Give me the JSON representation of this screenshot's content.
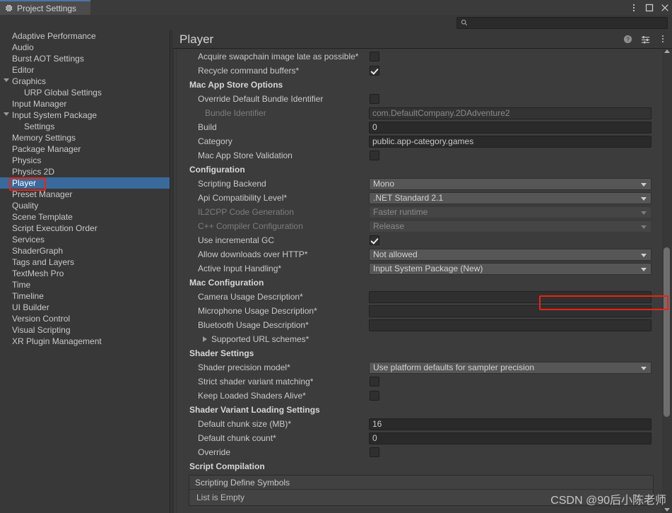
{
  "window": {
    "tab_label": "Project Settings",
    "tab_icon": "gear-icon",
    "menu_icon": "kebab-menu-icon",
    "maximize_icon": "maximize-icon",
    "close_icon": "close-icon"
  },
  "search": {
    "value": "",
    "placeholder": "",
    "icon": "search-icon"
  },
  "sidebar": {
    "items": [
      {
        "label": "Adaptive Performance",
        "indent": 0,
        "arrow": false,
        "selected": false
      },
      {
        "label": "Audio",
        "indent": 0,
        "arrow": false,
        "selected": false
      },
      {
        "label": "Burst AOT Settings",
        "indent": 0,
        "arrow": false,
        "selected": false
      },
      {
        "label": "Editor",
        "indent": 0,
        "arrow": false,
        "selected": false
      },
      {
        "label": "Graphics",
        "indent": 0,
        "arrow": true,
        "selected": false
      },
      {
        "label": "URP Global Settings",
        "indent": 1,
        "arrow": false,
        "selected": false
      },
      {
        "label": "Input Manager",
        "indent": 0,
        "arrow": false,
        "selected": false
      },
      {
        "label": "Input System Package",
        "indent": 0,
        "arrow": true,
        "selected": false
      },
      {
        "label": "Settings",
        "indent": 1,
        "arrow": false,
        "selected": false
      },
      {
        "label": "Memory Settings",
        "indent": 0,
        "arrow": false,
        "selected": false
      },
      {
        "label": "Package Manager",
        "indent": 0,
        "arrow": false,
        "selected": false
      },
      {
        "label": "Physics",
        "indent": 0,
        "arrow": false,
        "selected": false
      },
      {
        "label": "Physics 2D",
        "indent": 0,
        "arrow": false,
        "selected": false
      },
      {
        "label": "Player",
        "indent": 0,
        "arrow": false,
        "selected": true
      },
      {
        "label": "Preset Manager",
        "indent": 0,
        "arrow": false,
        "selected": false
      },
      {
        "label": "Quality",
        "indent": 0,
        "arrow": false,
        "selected": false
      },
      {
        "label": "Scene Template",
        "indent": 0,
        "arrow": false,
        "selected": false
      },
      {
        "label": "Script Execution Order",
        "indent": 0,
        "arrow": false,
        "selected": false
      },
      {
        "label": "Services",
        "indent": 0,
        "arrow": false,
        "selected": false
      },
      {
        "label": "ShaderGraph",
        "indent": 0,
        "arrow": false,
        "selected": false
      },
      {
        "label": "Tags and Layers",
        "indent": 0,
        "arrow": false,
        "selected": false
      },
      {
        "label": "TextMesh Pro",
        "indent": 0,
        "arrow": false,
        "selected": false
      },
      {
        "label": "Time",
        "indent": 0,
        "arrow": false,
        "selected": false
      },
      {
        "label": "Timeline",
        "indent": 0,
        "arrow": false,
        "selected": false
      },
      {
        "label": "UI Builder",
        "indent": 0,
        "arrow": false,
        "selected": false
      },
      {
        "label": "Version Control",
        "indent": 0,
        "arrow": false,
        "selected": false
      },
      {
        "label": "Visual Scripting",
        "indent": 0,
        "arrow": false,
        "selected": false
      },
      {
        "label": "XR Plugin Management",
        "indent": 0,
        "arrow": false,
        "selected": false
      }
    ]
  },
  "main": {
    "title": "Player",
    "help_icon": "help-icon",
    "preset_icon": "preset-settings-icon",
    "more_icon": "kebab-menu-icon"
  },
  "rows": [
    {
      "kind": "checkbox",
      "label": "Acquire swapchain image late as possible*",
      "indent": 1,
      "checked": false
    },
    {
      "kind": "checkbox",
      "label": "Recycle command buffers*",
      "indent": 1,
      "checked": true
    },
    {
      "kind": "section",
      "label": "Mac App Store Options"
    },
    {
      "kind": "checkbox",
      "label": "Override Default Bundle Identifier",
      "indent": 1,
      "checked": false
    },
    {
      "kind": "text",
      "label": "Bundle Identifier",
      "indent": 2,
      "value": "com.DefaultCompany.2DAdventure2",
      "disabled": true
    },
    {
      "kind": "text",
      "label": "Build",
      "indent": 1,
      "value": "0",
      "disabled": false
    },
    {
      "kind": "text",
      "label": "Category",
      "indent": 1,
      "value": "public.app-category.games",
      "disabled": false
    },
    {
      "kind": "checkbox",
      "label": "Mac App Store Validation",
      "indent": 1,
      "checked": false
    },
    {
      "kind": "section",
      "label": "Configuration"
    },
    {
      "kind": "dropdown",
      "label": "Scripting Backend",
      "indent": 1,
      "value": "Mono",
      "disabled": false
    },
    {
      "kind": "dropdown",
      "label": "Api Compatibility Level*",
      "indent": 1,
      "value": ".NET Standard 2.1",
      "disabled": false
    },
    {
      "kind": "dropdown",
      "label": "IL2CPP Code Generation",
      "indent": 1,
      "value": "Faster runtime",
      "disabled": true
    },
    {
      "kind": "dropdown",
      "label": "C++ Compiler Configuration",
      "indent": 1,
      "value": "Release",
      "disabled": true
    },
    {
      "kind": "checkbox",
      "label": "Use incremental GC",
      "indent": 1,
      "checked": true
    },
    {
      "kind": "dropdown",
      "label": "Allow downloads over HTTP*",
      "indent": 1,
      "value": "Not allowed",
      "disabled": false
    },
    {
      "kind": "dropdown",
      "label": "Active Input Handling*",
      "indent": 1,
      "value": "Input System Package (New)",
      "disabled": false,
      "highlighted": true
    },
    {
      "kind": "section",
      "label": "Mac Configuration"
    },
    {
      "kind": "text",
      "label": "Camera Usage Description*",
      "indent": 1,
      "value": "",
      "disabled": false
    },
    {
      "kind": "text",
      "label": "Microphone Usage Description*",
      "indent": 1,
      "value": "",
      "disabled": false
    },
    {
      "kind": "text",
      "label": "Bluetooth Usage Description*",
      "indent": 1,
      "value": "",
      "disabled": false
    },
    {
      "kind": "foldout",
      "label": "Supported URL schemes*",
      "indent": 1
    },
    {
      "kind": "section",
      "label": "Shader Settings"
    },
    {
      "kind": "dropdown",
      "label": "Shader precision model*",
      "indent": 1,
      "value": "Use platform defaults for sampler precision",
      "disabled": false
    },
    {
      "kind": "checkbox",
      "label": "Strict shader variant matching*",
      "indent": 1,
      "checked": false
    },
    {
      "kind": "checkbox",
      "label": "Keep Loaded Shaders Alive*",
      "indent": 1,
      "checked": false
    },
    {
      "kind": "section",
      "label": "Shader Variant Loading Settings"
    },
    {
      "kind": "text",
      "label": "Default chunk size (MB)*",
      "indent": 1,
      "value": "16",
      "disabled": false
    },
    {
      "kind": "text",
      "label": "Default chunk count*",
      "indent": 1,
      "value": "0",
      "disabled": false
    },
    {
      "kind": "checkbox",
      "label": "Override",
      "indent": 1,
      "checked": false
    },
    {
      "kind": "section",
      "label": "Script Compilation"
    }
  ],
  "list_box": {
    "header": "Scripting Define Symbols",
    "empty_text": "List is Empty"
  },
  "watermark": {
    "text": "CSDN @90后小陈老师"
  },
  "colors": {
    "accent_blue": "#4a76a8",
    "selection_blue": "#3a6a9c",
    "annotation_red": "#ee2211",
    "panel_bg": "#383838",
    "content_bg": "#3c3c3c"
  }
}
